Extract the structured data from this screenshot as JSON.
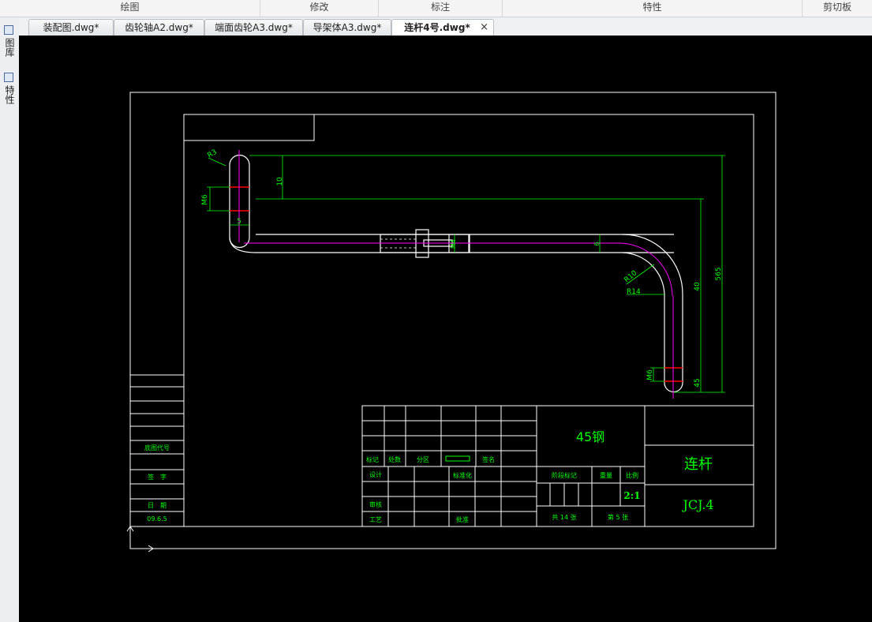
{
  "ribbon": {
    "sections": [
      {
        "label": "绘图"
      },
      {
        "label": "修改"
      },
      {
        "label": "标注"
      },
      {
        "label": "特性"
      },
      {
        "label": "剪切板"
      }
    ]
  },
  "tabs": [
    {
      "label": "装配图.dwg*"
    },
    {
      "label": "齿轮轴A2.dwg*"
    },
    {
      "label": "端面齿轮A3.dwg*"
    },
    {
      "label": "导架体A3.dwg*"
    },
    {
      "label": "连杆4号.dwg*",
      "active": true
    }
  ],
  "tab_close": "×",
  "left_panel": {
    "items": [
      {
        "label": "图库",
        "icon": "library-icon"
      },
      {
        "label": "特性",
        "icon": "properties-icon"
      }
    ]
  },
  "colors": {
    "canvas": "#000000",
    "geometry": "#ffffff",
    "dimension": "#00ff00",
    "centerline": "#ff00ff",
    "marker": "#ff0000"
  },
  "drawing": {
    "dims": {
      "r3": "R3",
      "d10": "10",
      "m6_top": "M6",
      "d5": "5",
      "m4": "M4",
      "d6": "6",
      "r10": "R10",
      "r14": "R14",
      "d40": "40",
      "d565": "565",
      "m6_bottom": "M6",
      "d45": "45"
    },
    "title_block": {
      "material": "45钢",
      "part_name": "连杆",
      "drawing_no": "JCJ.4",
      "scale_value": "2:1",
      "mark": "标记",
      "count": "处数",
      "zone": "分区",
      "sign": "签名",
      "design": "设计",
      "standardization": "标准化",
      "review": "审核",
      "process": "工艺",
      "approve": "批准",
      "stage_mark": "阶段标记",
      "weight": "重量",
      "scale": "比例",
      "total_sheets": "共 14 张",
      "sheet_no": "第 5 张"
    },
    "side_block": {
      "old_code": "底图代号",
      "signature": "签　字",
      "date": "日　期",
      "date_value": "09.6.5"
    }
  }
}
